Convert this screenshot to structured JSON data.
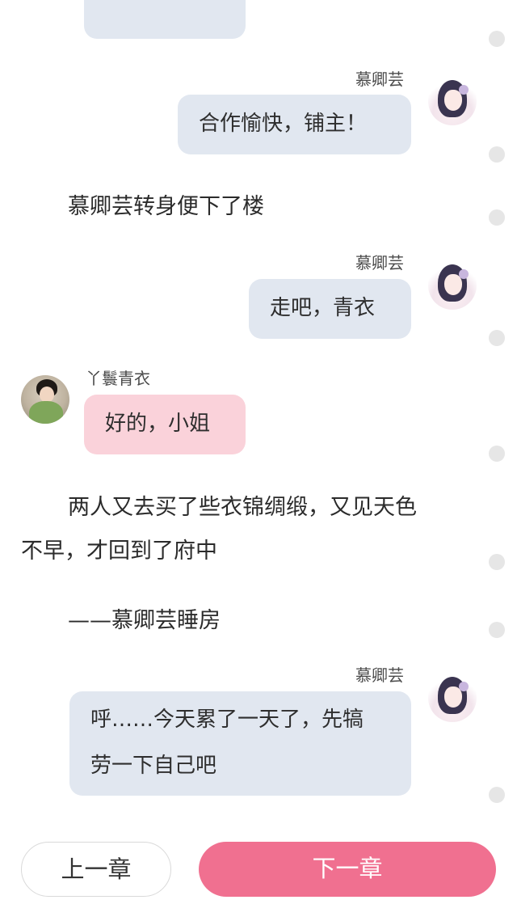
{
  "messages": [
    {
      "speaker": "慕卿芸",
      "text": "合作愉快，铺主！"
    },
    {
      "speaker": "慕卿芸",
      "text": "走吧，青衣"
    },
    {
      "speaker": "丫鬟青衣",
      "text": "好的，小姐"
    },
    {
      "speaker": "慕卿芸",
      "text_line1": "呼……今天累了一天了，先犒",
      "text_line2": "劳一下自己吧"
    }
  ],
  "narration": {
    "n1": "慕卿芸转身便下了楼",
    "n2_line1": "两人又去买了些衣锦绸缎，又见天色",
    "n2_line2": "不早，才回到了府中",
    "n3": "——慕卿芸睡房"
  },
  "nav": {
    "prev_label": "上一章",
    "next_label": "下一章"
  },
  "colors": {
    "accent": "#f07090",
    "bubble_self": "#e1e7f0",
    "bubble_other": "#fad2da"
  }
}
